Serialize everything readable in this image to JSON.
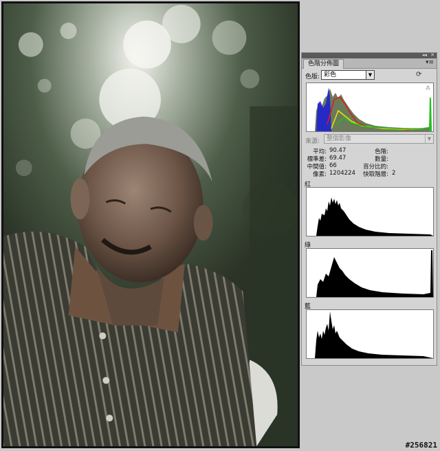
{
  "panel": {
    "tab_title": "色階分佈圖",
    "channel_label": "色版:",
    "channel_value": "彩色",
    "source_label": "來源:",
    "source_value": "整個影像",
    "stats": {
      "mean_label": "平均:",
      "mean_value": "90.47",
      "stddev_label": "標準差:",
      "stddev_value": "69.47",
      "median_label": "中間值:",
      "median_value": "66",
      "pixels_label": "像素:",
      "pixels_value": "1204224",
      "level_label": "色階:",
      "level_value": "",
      "count_label": "數量:",
      "count_value": "",
      "percentile_label": "百分比的:",
      "percentile_value": "",
      "cache_label": "快取階層:",
      "cache_value": "2"
    },
    "channels": [
      {
        "label": "紅",
        "color": "#000000"
      },
      {
        "label": "綠",
        "color": "#000000"
      },
      {
        "label": "藍",
        "color": "#000000"
      }
    ]
  },
  "watermark": "#256821",
  "icons": {
    "panel_menu": "menu-icon",
    "refresh": "refresh-icon",
    "warning": "warning-icon",
    "collapse": "double-arrow-icon",
    "close": "close-icon"
  }
}
